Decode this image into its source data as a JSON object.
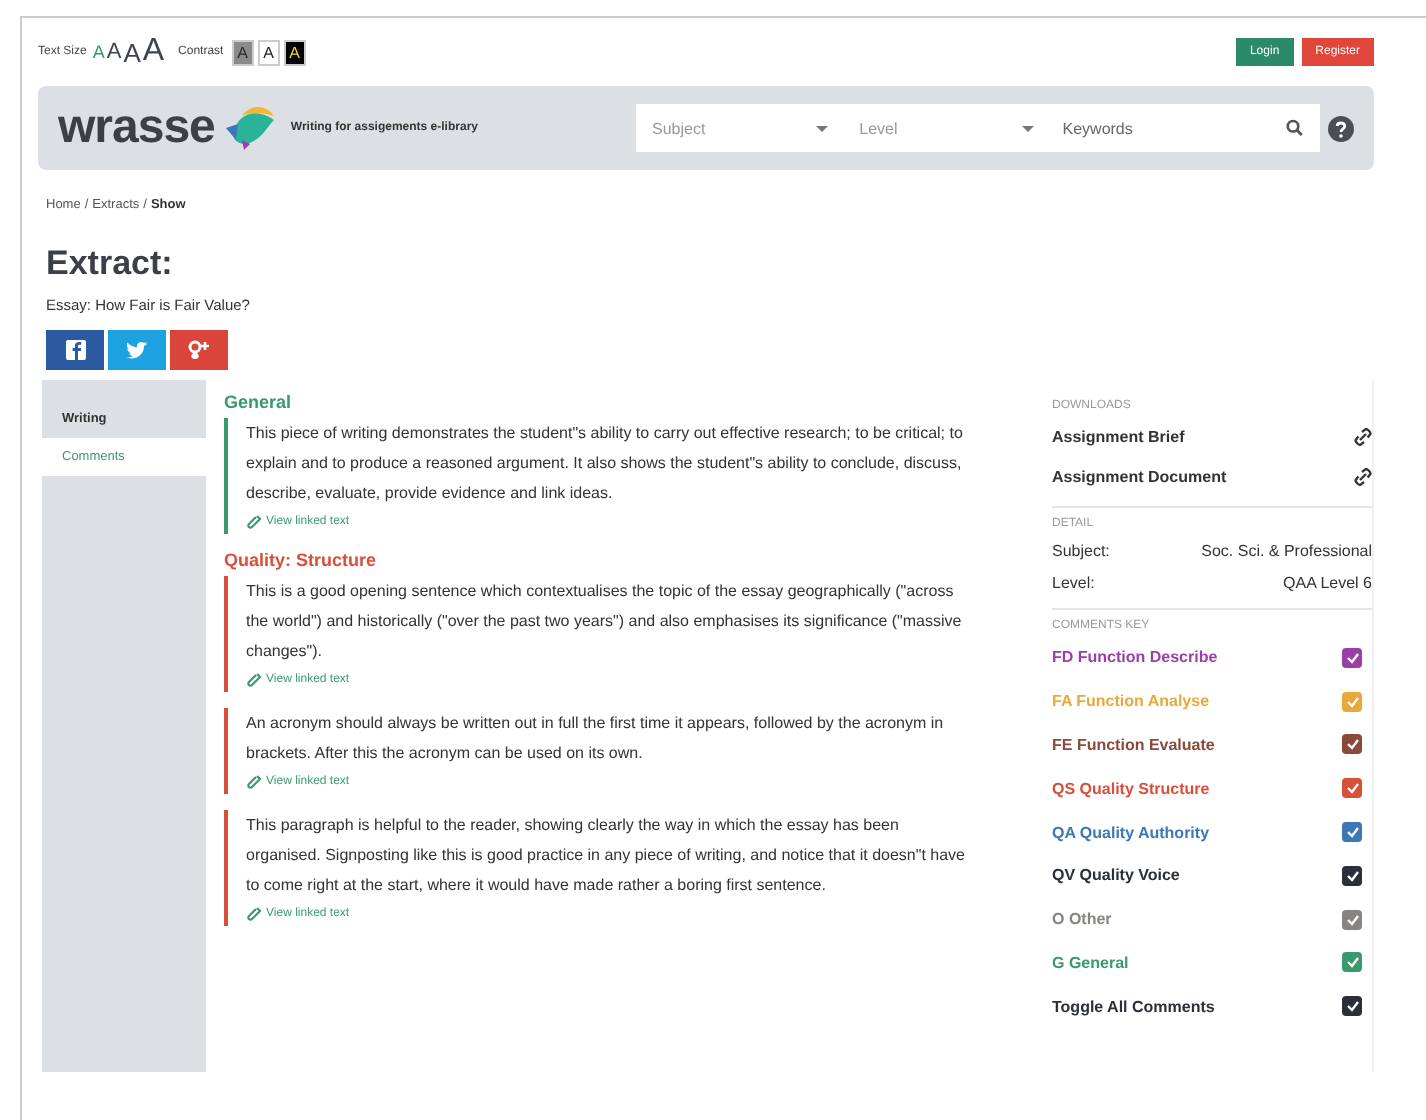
{
  "topbar": {
    "text_size_label": "Text Size",
    "text_sizes": [
      {
        "label": "A",
        "selected": true
      },
      {
        "label": "A",
        "selected": false
      },
      {
        "label": "A",
        "selected": false
      },
      {
        "label": "A",
        "selected": false
      }
    ],
    "contrast_label": "Contrast",
    "contrasts": [
      {
        "label": "A",
        "kind": "grey"
      },
      {
        "label": "A",
        "kind": "light"
      },
      {
        "label": "A",
        "kind": "dark"
      }
    ],
    "buttons": [
      {
        "label": "Login",
        "kind": "login"
      },
      {
        "label": "Register",
        "kind": "register"
      }
    ]
  },
  "header": {
    "logo": "wrasse",
    "tagline": "Writing for assigements e-library",
    "subject": {
      "placeholder": "Subject"
    },
    "level": {
      "placeholder": "Level"
    },
    "keywords": {
      "placeholder": "Keywords"
    }
  },
  "breadcrumb_separator": "/",
  "breadcrumb": [
    {
      "label": "Home",
      "current": false
    },
    {
      "label": "Extracts",
      "current": false
    },
    {
      "label": "Show",
      "current": true
    }
  ],
  "title": "Extract:",
  "subtitle": "Essay: How Fair is Fair Value?",
  "tabs": [
    {
      "label": "Writing",
      "selected": false
    },
    {
      "label": "Comments",
      "selected": true
    }
  ],
  "comment_groups": [
    {
      "heading": "General",
      "color": "#3a9a6e",
      "comments": [
        {
          "text": "This piece of writing demonstrates the student\"s ability to carry out effective research; to be critical; to explain and to produce a reasoned argument. It also shows the student\"s ability to conclude, discuss, describe, evaluate, provide evidence and link ideas.",
          "link": "View linked text"
        }
      ]
    },
    {
      "heading": "Quality: Structure",
      "color": "#d9503a",
      "comments": [
        {
          "text": "This is a good opening sentence which contextualises the topic of the essay geographically (\"across the world\") and historically (\"over the past two years\") and also emphasises its significance (\"massive changes\").",
          "link": "View linked text"
        },
        {
          "text": "An acronym should always be written out in full the first time it appears, followed by the acronym in brackets. After this the acronym can be used on its own.",
          "link": "View linked text"
        },
        {
          "text": "This paragraph is helpful to the reader, showing clearly the way in which the essay has been organised. Signposting like this is good practice in any piece of writing, and notice that it doesn\"t have to come right at the start, where it would have made rather a boring first sentence.",
          "link": "View linked text"
        }
      ]
    }
  ],
  "downloads": {
    "heading": "DOWNLOADS",
    "items": [
      "Assignment Brief",
      "Assignment Document"
    ]
  },
  "detail": {
    "heading": "DETAIL",
    "rows": [
      {
        "label": "Subject:",
        "value": "Soc. Sci. & Professional"
      },
      {
        "label": "Level:",
        "value": "QAA Level 6"
      }
    ]
  },
  "comments_key": {
    "heading": "COMMENTS KEY",
    "items": [
      {
        "label": "FD Function Describe",
        "color": "#9b3fa6",
        "checked": true
      },
      {
        "label": "FA Function Analyse",
        "color": "#e8a93a",
        "checked": true
      },
      {
        "label": "FE Function Evaluate",
        "color": "#8a4a3a",
        "checked": true
      },
      {
        "label": "QS Quality Structure",
        "color": "#d9503a",
        "checked": true
      },
      {
        "label": "QA Quality Authority",
        "color": "#3c78b8",
        "checked": true
      },
      {
        "label": "QV Quality Voice",
        "color": "#2a2f3a",
        "checked": true
      },
      {
        "label": "O Other",
        "color": "#8a8480",
        "checked": true
      },
      {
        "label": "G General",
        "color": "#3a9a6e",
        "checked": true
      },
      {
        "label": "Toggle All Comments",
        "color": "#2a2f3a",
        "checked": true
      }
    ]
  }
}
